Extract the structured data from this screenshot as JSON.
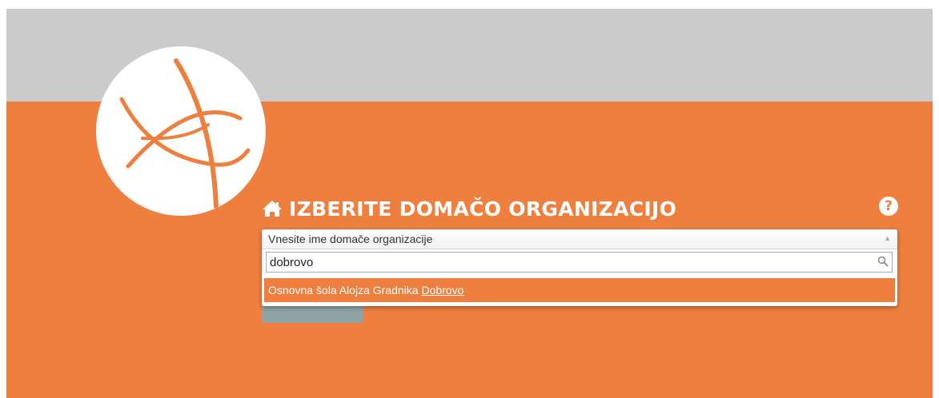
{
  "colors": {
    "orange": "#ef7f3f",
    "gray_band": "#cbcbcb",
    "white": "#ffffff"
  },
  "logo": {
    "icon": "orbit-arcs-logo"
  },
  "heading": {
    "icon": "home-icon",
    "title": "IZBERITE DOMAČO ORGANIZACIJO"
  },
  "help": {
    "icon": "question-circle-icon",
    "glyph": "?"
  },
  "select": {
    "placeholder": "Vnesite ime domače organizacije",
    "arrow": "▲",
    "search_value": "dobrovo",
    "search_icon": "search-icon",
    "results": [
      {
        "prefix": "Osnovna šola Alojza Gradnika ",
        "match": "Dobrovo"
      }
    ]
  }
}
